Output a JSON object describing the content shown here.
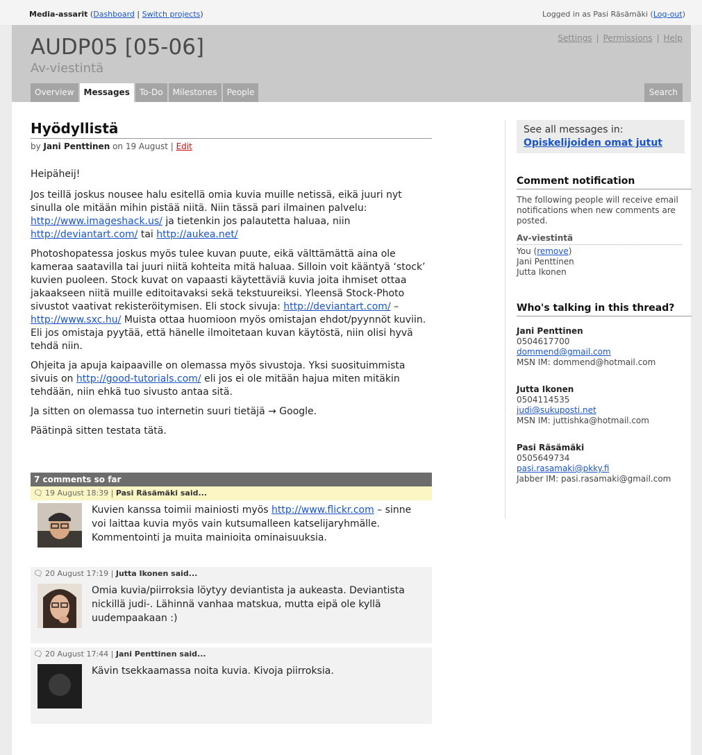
{
  "topbar": {
    "account": "Media-assarit",
    "dashboard": "Dashboard",
    "switch": "Switch projects",
    "logged_in": "Logged in as Pasi Räsämäki",
    "logout": "Log-out"
  },
  "header": {
    "title": "AUDP05 [05-06]",
    "subtitle": "Av-viestintä",
    "links": [
      "Settings",
      "Permissions",
      "Help"
    ],
    "tabs": [
      "Overview",
      "Messages",
      "To-Do",
      "Milestones",
      "People"
    ],
    "active_tab": "Messages",
    "search": "Search"
  },
  "message": {
    "title": "Hyödyllistä",
    "by": "by",
    "author": "Jani Penttinen",
    "on": "on 19 August |",
    "edit": "Edit",
    "p1": "Heipäheij!",
    "p2": "Jos teillä joskus nousee halu esitellä omia kuvia muille netissä, eikä juuri nyt sinulla ole mitään mihin pistää niitä. Niin tässä pari ilmainen palvelu:",
    "p2_link1": "http://www.imageshack.us/",
    "p2_mid": "ja tietenkin jos palautetta haluaa, niin",
    "p2_link2": "http://deviantart.com/",
    "p2_tai": "tai",
    "p2_link3": "http://aukea.net/",
    "p3a": "Photoshopatessa joskus myös tulee kuvan puute, eikä välttämättä aina ole kameraa saatavilla tai juuri niitä kohteita mitä haluaa. Silloin voit kääntyä ‘stock’ kuvien puoleen. Stock kuvat on vapaasti käytettäviä kuvia joita ihmiset ottaa jakaakseen niitä muille editoitavaksi sekä tekstuureiksi. Yleensä Stock-Photo sivustot vaativat rekisteröitymisen. Eli stock sivuja:",
    "p3_link1": "http://deviantart.com/",
    "p3_dash": "–",
    "p3_link2": "http://www.sxc.hu/",
    "p3b": "Muista ottaa huomioon myös omistajan ehdot/pyynnöt kuviin. Eli jos omistaja pyytää, että hänelle ilmoitetaan kuvan käytöstä, niin olisi hyvä tehdä niin.",
    "p4a": "Ohjeita ja apuja kaipaaville on olemassa myös sivustoja. Yksi suosituimmista sivuis on",
    "p4_link": "http://good-tutorials.com/",
    "p4b": "eli jos ei ole mitään hajua miten mitäkin tehdään, niin ehkä tuo sivusto antaa sitä.",
    "p5": "Ja sitten on olemassa tuo internetin suuri tietäjä → Google.",
    "p6": "Päätinpä sitten testata tätä."
  },
  "comments": {
    "header": "7 comments so far",
    "items": [
      {
        "date": "19 August 18:39 |",
        "author": "Pasi Räsämäki said...",
        "text_a": "Kuvien kanssa toimii mainiosti myös",
        "link": "http://www.flickr.com",
        "text_b": "– sinne voi laittaa kuvia myös vain kutsumalleen katselijaryhmälle. Kommentointi ja muita mainioita ominaisuuksia."
      },
      {
        "date": "20 August 17:19 |",
        "author": "Jutta Ikonen said...",
        "text": "Omia kuvia/piirroksia löytyy deviantista ja aukeasta. Deviantista nickillä judi-. Lähinnä vanhaa matskua, mutta eipä ole kyllä uudempaakaan :)"
      },
      {
        "date": "20 August 17:44 |",
        "author": "Jani Penttinen said...",
        "text": "Kävin tsekkaamassa noita kuvia. Kivoja piirroksia."
      }
    ]
  },
  "sidebar": {
    "see_all_label": "See all messages in:",
    "see_all_link": "Opiskelijoiden omat jutut",
    "notif_heading": "Comment notification",
    "notif_text": "The following people will receive email notifications when new comments are posted.",
    "notif_group": "Av-viestintä",
    "you": "You (",
    "remove": "remove",
    "you_close": ")",
    "notif_people": [
      "Jani Penttinen",
      "Jutta Ikonen"
    ],
    "talk_heading": "Who's talking in this thread?",
    "people": [
      {
        "name": "Jani Penttinen",
        "phone": "0504617700",
        "email": "dommend@gmail.com",
        "im": "MSN IM: dommend@hotmail.com"
      },
      {
        "name": "Jutta Ikonen",
        "phone": "0504114535",
        "email": "judi@sukuposti.net",
        "im": "MSN IM: juttishka@hotmail.com"
      },
      {
        "name": "Pasi Räsämäki",
        "phone": "0505649734",
        "email": "pasi.rasamaki@pkky.fi",
        "im": "Jabber IM: pasi.rasamaki@gmail.com"
      }
    ]
  }
}
